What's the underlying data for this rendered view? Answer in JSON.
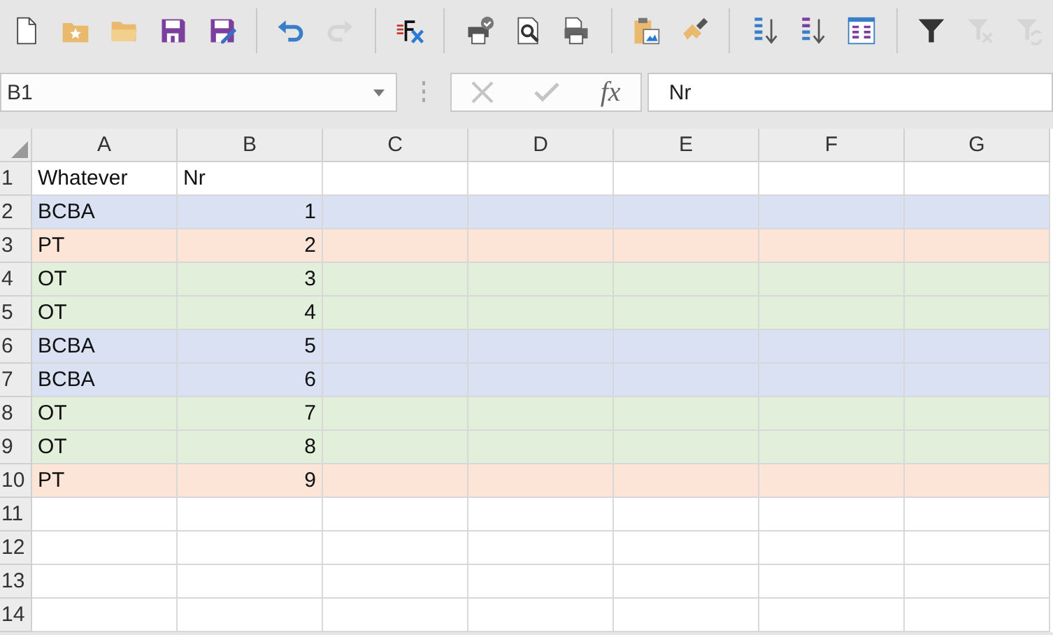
{
  "toolbar": [
    [
      {
        "kind": "new",
        "disabled": false
      },
      {
        "kind": "favorites",
        "disabled": false
      },
      {
        "kind": "open",
        "disabled": false
      },
      {
        "kind": "save",
        "disabled": false
      },
      {
        "kind": "saveas",
        "disabled": false
      }
    ],
    [
      {
        "kind": "undo",
        "disabled": false
      },
      {
        "kind": "redo",
        "disabled": true
      }
    ],
    [
      {
        "kind": "clearformat",
        "disabled": false
      }
    ],
    [
      {
        "kind": "printer",
        "disabled": false
      },
      {
        "kind": "preview",
        "disabled": false
      },
      {
        "kind": "print",
        "disabled": false
      }
    ],
    [
      {
        "kind": "paste",
        "disabled": false
      },
      {
        "kind": "brush",
        "disabled": false
      }
    ],
    [
      {
        "kind": "sortasc",
        "disabled": false
      },
      {
        "kind": "sortdesc",
        "disabled": false
      },
      {
        "kind": "sortcustom",
        "disabled": false
      }
    ],
    [
      {
        "kind": "filter",
        "disabled": false
      },
      {
        "kind": "clearfilter",
        "disabled": true
      },
      {
        "kind": "reapply",
        "disabled": true
      }
    ]
  ],
  "formula_bar": {
    "name_box": "B1",
    "cancel_disabled": true,
    "accept_disabled": true,
    "function_label": "fx",
    "value": "Nr"
  },
  "columns": [
    "A",
    "B",
    "C",
    "D",
    "E",
    "F",
    "G"
  ],
  "rows": [
    {
      "number": "1",
      "cells": [
        "Whatever",
        "Nr"
      ]
    },
    {
      "number": "2",
      "cells": [
        "BCBA",
        "1"
      ],
      "color": "#d9e1f2"
    },
    {
      "number": "3",
      "cells": [
        "PT",
        "2"
      ],
      "color": "#fce4d6"
    },
    {
      "number": "4",
      "cells": [
        "OT",
        "3"
      ],
      "color": "#e2efda"
    },
    {
      "number": "5",
      "cells": [
        "OT",
        "4"
      ],
      "color": "#e2efda"
    },
    {
      "number": "6",
      "cells": [
        "BCBA",
        "5"
      ],
      "color": "#d9e1f2"
    },
    {
      "number": "7",
      "cells": [
        "BCBA",
        "6"
      ],
      "color": "#d9e1f2"
    },
    {
      "number": "8",
      "cells": [
        "OT",
        "7"
      ],
      "color": "#e2efda"
    },
    {
      "number": "9",
      "cells": [
        "OT",
        "8"
      ],
      "color": "#e2efda"
    },
    {
      "number": "10",
      "cells": [
        "PT",
        "9"
      ],
      "color": "#fce4d6"
    },
    {
      "number": "11",
      "cells": []
    },
    {
      "number": "12",
      "cells": []
    },
    {
      "number": "13",
      "cells": []
    },
    {
      "number": "14",
      "cells": []
    }
  ]
}
